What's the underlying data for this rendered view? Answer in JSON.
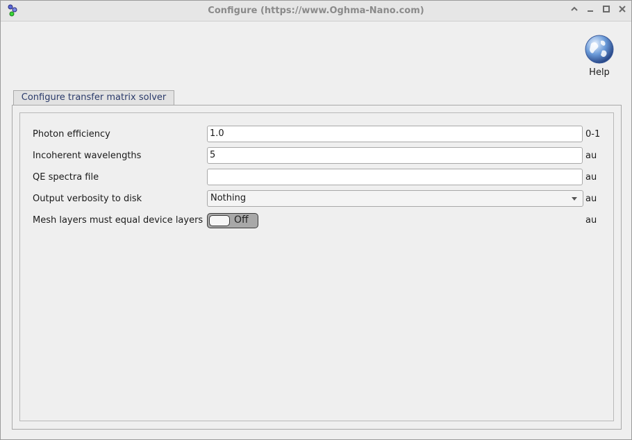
{
  "window": {
    "title": "Configure (https://www.Oghma-Nano.com)",
    "controls": {
      "up": "^",
      "minimize": "–",
      "maximize": "□",
      "close": "✕"
    }
  },
  "toolbar": {
    "help_label": "Help",
    "help_icon": "globe-help-icon"
  },
  "tabs": [
    {
      "label": "Configure transfer matrix solver",
      "active": true
    }
  ],
  "form": {
    "rows": [
      {
        "label": "Photon efficiency",
        "type": "text",
        "value": "1.0",
        "unit": "0-1"
      },
      {
        "label": "Incoherent wavelengths",
        "type": "text",
        "value": "5",
        "unit": "au"
      },
      {
        "label": "QE spectra file",
        "type": "text",
        "value": "",
        "unit": "au"
      },
      {
        "label": "Output verbosity to disk",
        "type": "select",
        "value": "Nothing",
        "unit": "au"
      },
      {
        "label": "Mesh layers must equal device layers",
        "type": "toggle",
        "value": "Off",
        "unit": "au"
      }
    ]
  },
  "colors": {
    "tab_underline": "#4a5fa8",
    "window_bg": "#efefef",
    "title_text": "#8a8a8a"
  }
}
